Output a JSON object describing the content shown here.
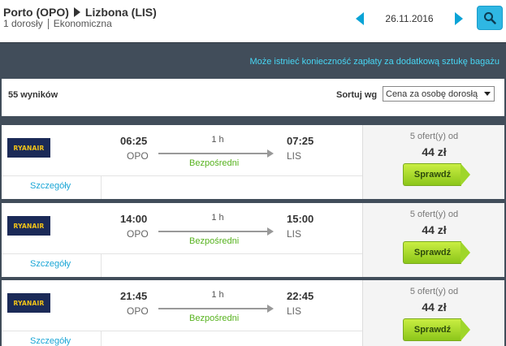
{
  "header": {
    "origin": "Porto (OPO)",
    "destination": "Lizbona (LIS)",
    "passengers": "1 dorosły",
    "cabin": "Ekonomiczna",
    "date": "26.11.2016"
  },
  "panel": {
    "notice": "Może istnieć konieczność zapłaty za dodatkową sztukę bagażu",
    "results_count": "55 wyników",
    "sort_label": "Sortuj wg",
    "sort_value": "Cena za osobę dorosłą"
  },
  "flights": [
    {
      "airline": "RYANAIR",
      "dep_time": "06:25",
      "dep_code": "OPO",
      "duration": "1 h",
      "stops": "Bezpośredni",
      "arr_time": "07:25",
      "arr_code": "LIS",
      "offers": "5 ofert(y) od",
      "price": "44 zł",
      "buy_label": "Sprawdź",
      "details_label": "Szczegóły"
    },
    {
      "airline": "RYANAIR",
      "dep_time": "14:00",
      "dep_code": "OPO",
      "duration": "1 h",
      "stops": "Bezpośredni",
      "arr_time": "15:00",
      "arr_code": "LIS",
      "offers": "5 ofert(y) od",
      "price": "44 zł",
      "buy_label": "Sprawdź",
      "details_label": "Szczegóły"
    },
    {
      "airline": "RYANAIR",
      "dep_time": "21:45",
      "dep_code": "OPO",
      "duration": "1 h",
      "stops": "Bezpośredni",
      "arr_time": "22:45",
      "arr_code": "LIS",
      "offers": "5 ofert(y) od",
      "price": "44 zł",
      "buy_label": "Sprawdź",
      "details_label": "Szczegóły"
    }
  ],
  "colors": {
    "accent": "#0aa3d6",
    "notice": "#47d6f4",
    "direct": "#56b21d",
    "panel_bg": "#414d5a",
    "buy_button": "#9fd62a",
    "airline_logo_bg": "#1b2a57",
    "airline_logo_text": "#f5c518"
  },
  "icons": {
    "prev": "chevron-left-icon",
    "next": "chevron-right-icon",
    "search": "search-icon",
    "route_arrow": "arrow-right-icon"
  }
}
